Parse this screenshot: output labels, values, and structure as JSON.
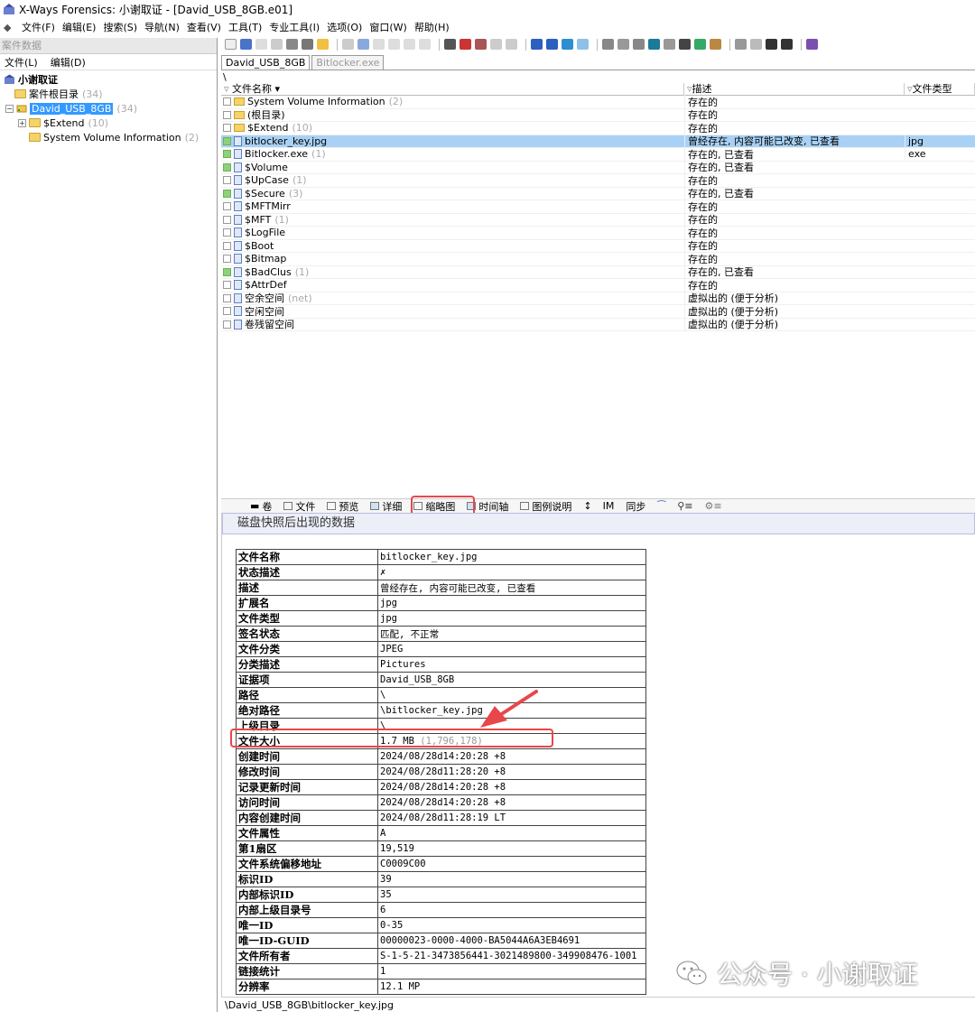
{
  "window": {
    "title": "X-Ways Forensics: 小谢取证 - [David_USB_8GB.e01]"
  },
  "menubar": [
    "文件(F)",
    "编辑(E)",
    "搜索(S)",
    "导航(N)",
    "查看(V)",
    "工具(T)",
    "专业工具(I)",
    "选项(O)",
    "窗口(W)",
    "帮助(H)"
  ],
  "left_pane": {
    "header": "案件数据",
    "menu": [
      "文件(L)",
      "编辑(D)"
    ],
    "tree": [
      {
        "label": "小谢取证",
        "count": ""
      },
      {
        "label": "案件根目录",
        "count": "(34)"
      },
      {
        "label": "David_USB_8GB",
        "count": "(34)"
      },
      {
        "label": "$Extend",
        "count": "(10)"
      },
      {
        "label": "System Volume Information",
        "count": "(2)"
      }
    ]
  },
  "tabs": [
    "David_USB_8GB",
    "Bitlocker.exe"
  ],
  "path": "\\",
  "file_list": {
    "columns": [
      "文件名称",
      "描述",
      "文件类型"
    ],
    "rows": [
      {
        "name": "System Volume Information",
        "count": "(2)",
        "desc": "存在的",
        "type": ""
      },
      {
        "name": "(根目录)",
        "count": "",
        "desc": "存在的",
        "type": ""
      },
      {
        "name": "$Extend",
        "count": "(10)",
        "desc": "存在的",
        "type": ""
      },
      {
        "name": "bitlocker_key.jpg",
        "count": "",
        "desc": "曾经存在, 内容可能已改变, 已查看",
        "type": "jpg"
      },
      {
        "name": "Bitlocker.exe",
        "count": "(1)",
        "desc": "存在的, 已查看",
        "type": "exe"
      },
      {
        "name": "$Volume",
        "count": "",
        "desc": "存在的, 已查看",
        "type": ""
      },
      {
        "name": "$UpCase",
        "count": "(1)",
        "desc": "存在的",
        "type": ""
      },
      {
        "name": "$Secure",
        "count": "(3)",
        "desc": "存在的, 已查看",
        "type": ""
      },
      {
        "name": "$MFTMirr",
        "count": "",
        "desc": "存在的",
        "type": ""
      },
      {
        "name": "$MFT",
        "count": "(1)",
        "desc": "存在的",
        "type": ""
      },
      {
        "name": "$LogFile",
        "count": "",
        "desc": "存在的",
        "type": ""
      },
      {
        "name": "$Boot",
        "count": "",
        "desc": "存在的",
        "type": ""
      },
      {
        "name": "$Bitmap",
        "count": "",
        "desc": "存在的",
        "type": ""
      },
      {
        "name": "$BadClus",
        "count": "(1)",
        "desc": "存在的, 已查看",
        "type": ""
      },
      {
        "name": "$AttrDef",
        "count": "",
        "desc": "存在的",
        "type": ""
      },
      {
        "name": "空余空间",
        "count": "(net)",
        "desc": "虚拟出的 (便于分析)",
        "type": ""
      },
      {
        "name": "空闲空间",
        "count": "",
        "desc": "虚拟出的 (便于分析)",
        "type": ""
      },
      {
        "name": "卷残留空间",
        "count": "",
        "desc": "虚拟出的 (便于分析)",
        "type": ""
      }
    ]
  },
  "detail_toolbar": [
    "卷",
    "文件",
    "预览",
    "详细",
    "缩略图",
    "时间轴",
    "图例说明",
    "IM",
    "同步"
  ],
  "detail": {
    "heading": "磁盘快照后出现的数据",
    "properties": [
      {
        "k": "文件名称",
        "v": "bitlocker_key.jpg"
      },
      {
        "k": "状态描述",
        "v": "✗"
      },
      {
        "k": "描述",
        "v": "曾经存在, 内容可能已改变, 已查看"
      },
      {
        "k": "扩展名",
        "v": "jpg"
      },
      {
        "k": "文件类型",
        "v": "jpg"
      },
      {
        "k": "签名状态",
        "v": "匹配, 不正常"
      },
      {
        "k": "文件分类",
        "v": "JPEG"
      },
      {
        "k": "分类描述",
        "v": "Pictures"
      },
      {
        "k": "证据项",
        "v": "David_USB_8GB"
      },
      {
        "k": "路径",
        "v": "\\"
      },
      {
        "k": "绝对路径",
        "v": "\\bitlocker_key.jpg"
      },
      {
        "k": "上级目录",
        "v": "\\"
      },
      {
        "k": "文件大小",
        "v": "1.7 MB",
        "extra": "(1,796,178)"
      },
      {
        "k": "创建时间",
        "v": "2024/08/28d14:20:28 +8"
      },
      {
        "k": "修改时间",
        "v": "2024/08/28d11:28:20 +8"
      },
      {
        "k": "记录更新时间",
        "v": "2024/08/28d14:20:28 +8"
      },
      {
        "k": "访问时间",
        "v": "2024/08/28d14:20:28 +8"
      },
      {
        "k": "内容创建时间",
        "v": "2024/08/28d11:28:19 LT"
      },
      {
        "k": "文件属性",
        "v": "A"
      },
      {
        "k": "第1扇区",
        "v": "19,519"
      },
      {
        "k": "文件系统偏移地址",
        "v": "C0009C00"
      },
      {
        "k": "标识ID",
        "v": "39"
      },
      {
        "k": "内部标识ID",
        "v": "35"
      },
      {
        "k": "内部上级目录号",
        "v": "6"
      },
      {
        "k": "唯一ID",
        "v": "0-35"
      },
      {
        "k": "唯一ID-GUID",
        "v": "00000023-0000-4000-BA5044A6A3EB4691"
      },
      {
        "k": "文件所有者",
        "v": "S-1-5-21-3473856441-3021489800-349908476-1001"
      },
      {
        "k": "链接统计",
        "v": "1"
      },
      {
        "k": "分辨率",
        "v": "12.1 MP"
      }
    ]
  },
  "statusbar": "\\David_USB_8GB\\bitlocker_key.jpg",
  "watermark": "公众号 · 小谢取证",
  "colors": {
    "selection": "#3399ff",
    "row_selection": "#a9d1f5",
    "highlight": "#e8474a"
  }
}
